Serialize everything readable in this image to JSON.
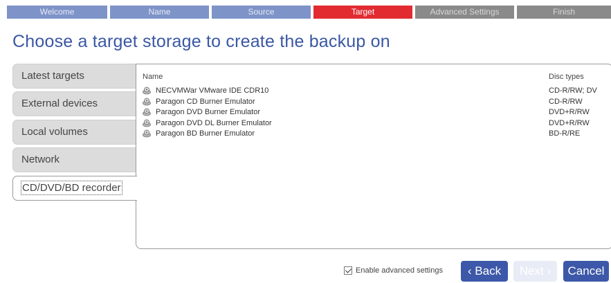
{
  "steps": [
    {
      "label": "Welcome",
      "state": "done"
    },
    {
      "label": "Name",
      "state": "done"
    },
    {
      "label": "Source",
      "state": "done"
    },
    {
      "label": "Target",
      "state": "current"
    },
    {
      "label": "Advanced Settings",
      "state": "todo"
    },
    {
      "label": "Finish",
      "state": "todo"
    }
  ],
  "page_title": "Choose a target storage to create the backup on",
  "tabs": [
    {
      "label": "Latest targets"
    },
    {
      "label": "External devices"
    },
    {
      "label": "Local volumes"
    },
    {
      "label": "Network"
    },
    {
      "label": "CD/DVD/BD recorder",
      "active": true
    }
  ],
  "list": {
    "columns": {
      "name": "Name",
      "disc": "Disc types"
    },
    "rows": [
      {
        "name": "NECVMWar VMware IDE CDR10",
        "disc": "CD-R/RW; DV...",
        "icon": "optical-drive-icon"
      },
      {
        "name": "Paragon CD Burner Emulator",
        "disc": "CD-R/RW",
        "icon": "optical-drive-icon"
      },
      {
        "name": "Paragon DVD Burner Emulator",
        "disc": "DVD+R/RW",
        "icon": "optical-drive-icon"
      },
      {
        "name": "Paragon DVD DL Burner Emulator",
        "disc": "DVD+R/RW",
        "icon": "optical-drive-icon"
      },
      {
        "name": "Paragon BD Burner Emulator",
        "disc": "BD-R/RE",
        "icon": "optical-drive-icon"
      }
    ]
  },
  "footer": {
    "advanced_label": "Enable advanced settings",
    "advanced_checked": true,
    "back_label": "‹ Back",
    "next_label": "Next ›",
    "cancel_label": "Cancel"
  },
  "colors": {
    "accent": "#3d58a8",
    "current_step": "#e12b31",
    "done_step": "#7e93c7",
    "todo_step": "#8a8a8a"
  }
}
